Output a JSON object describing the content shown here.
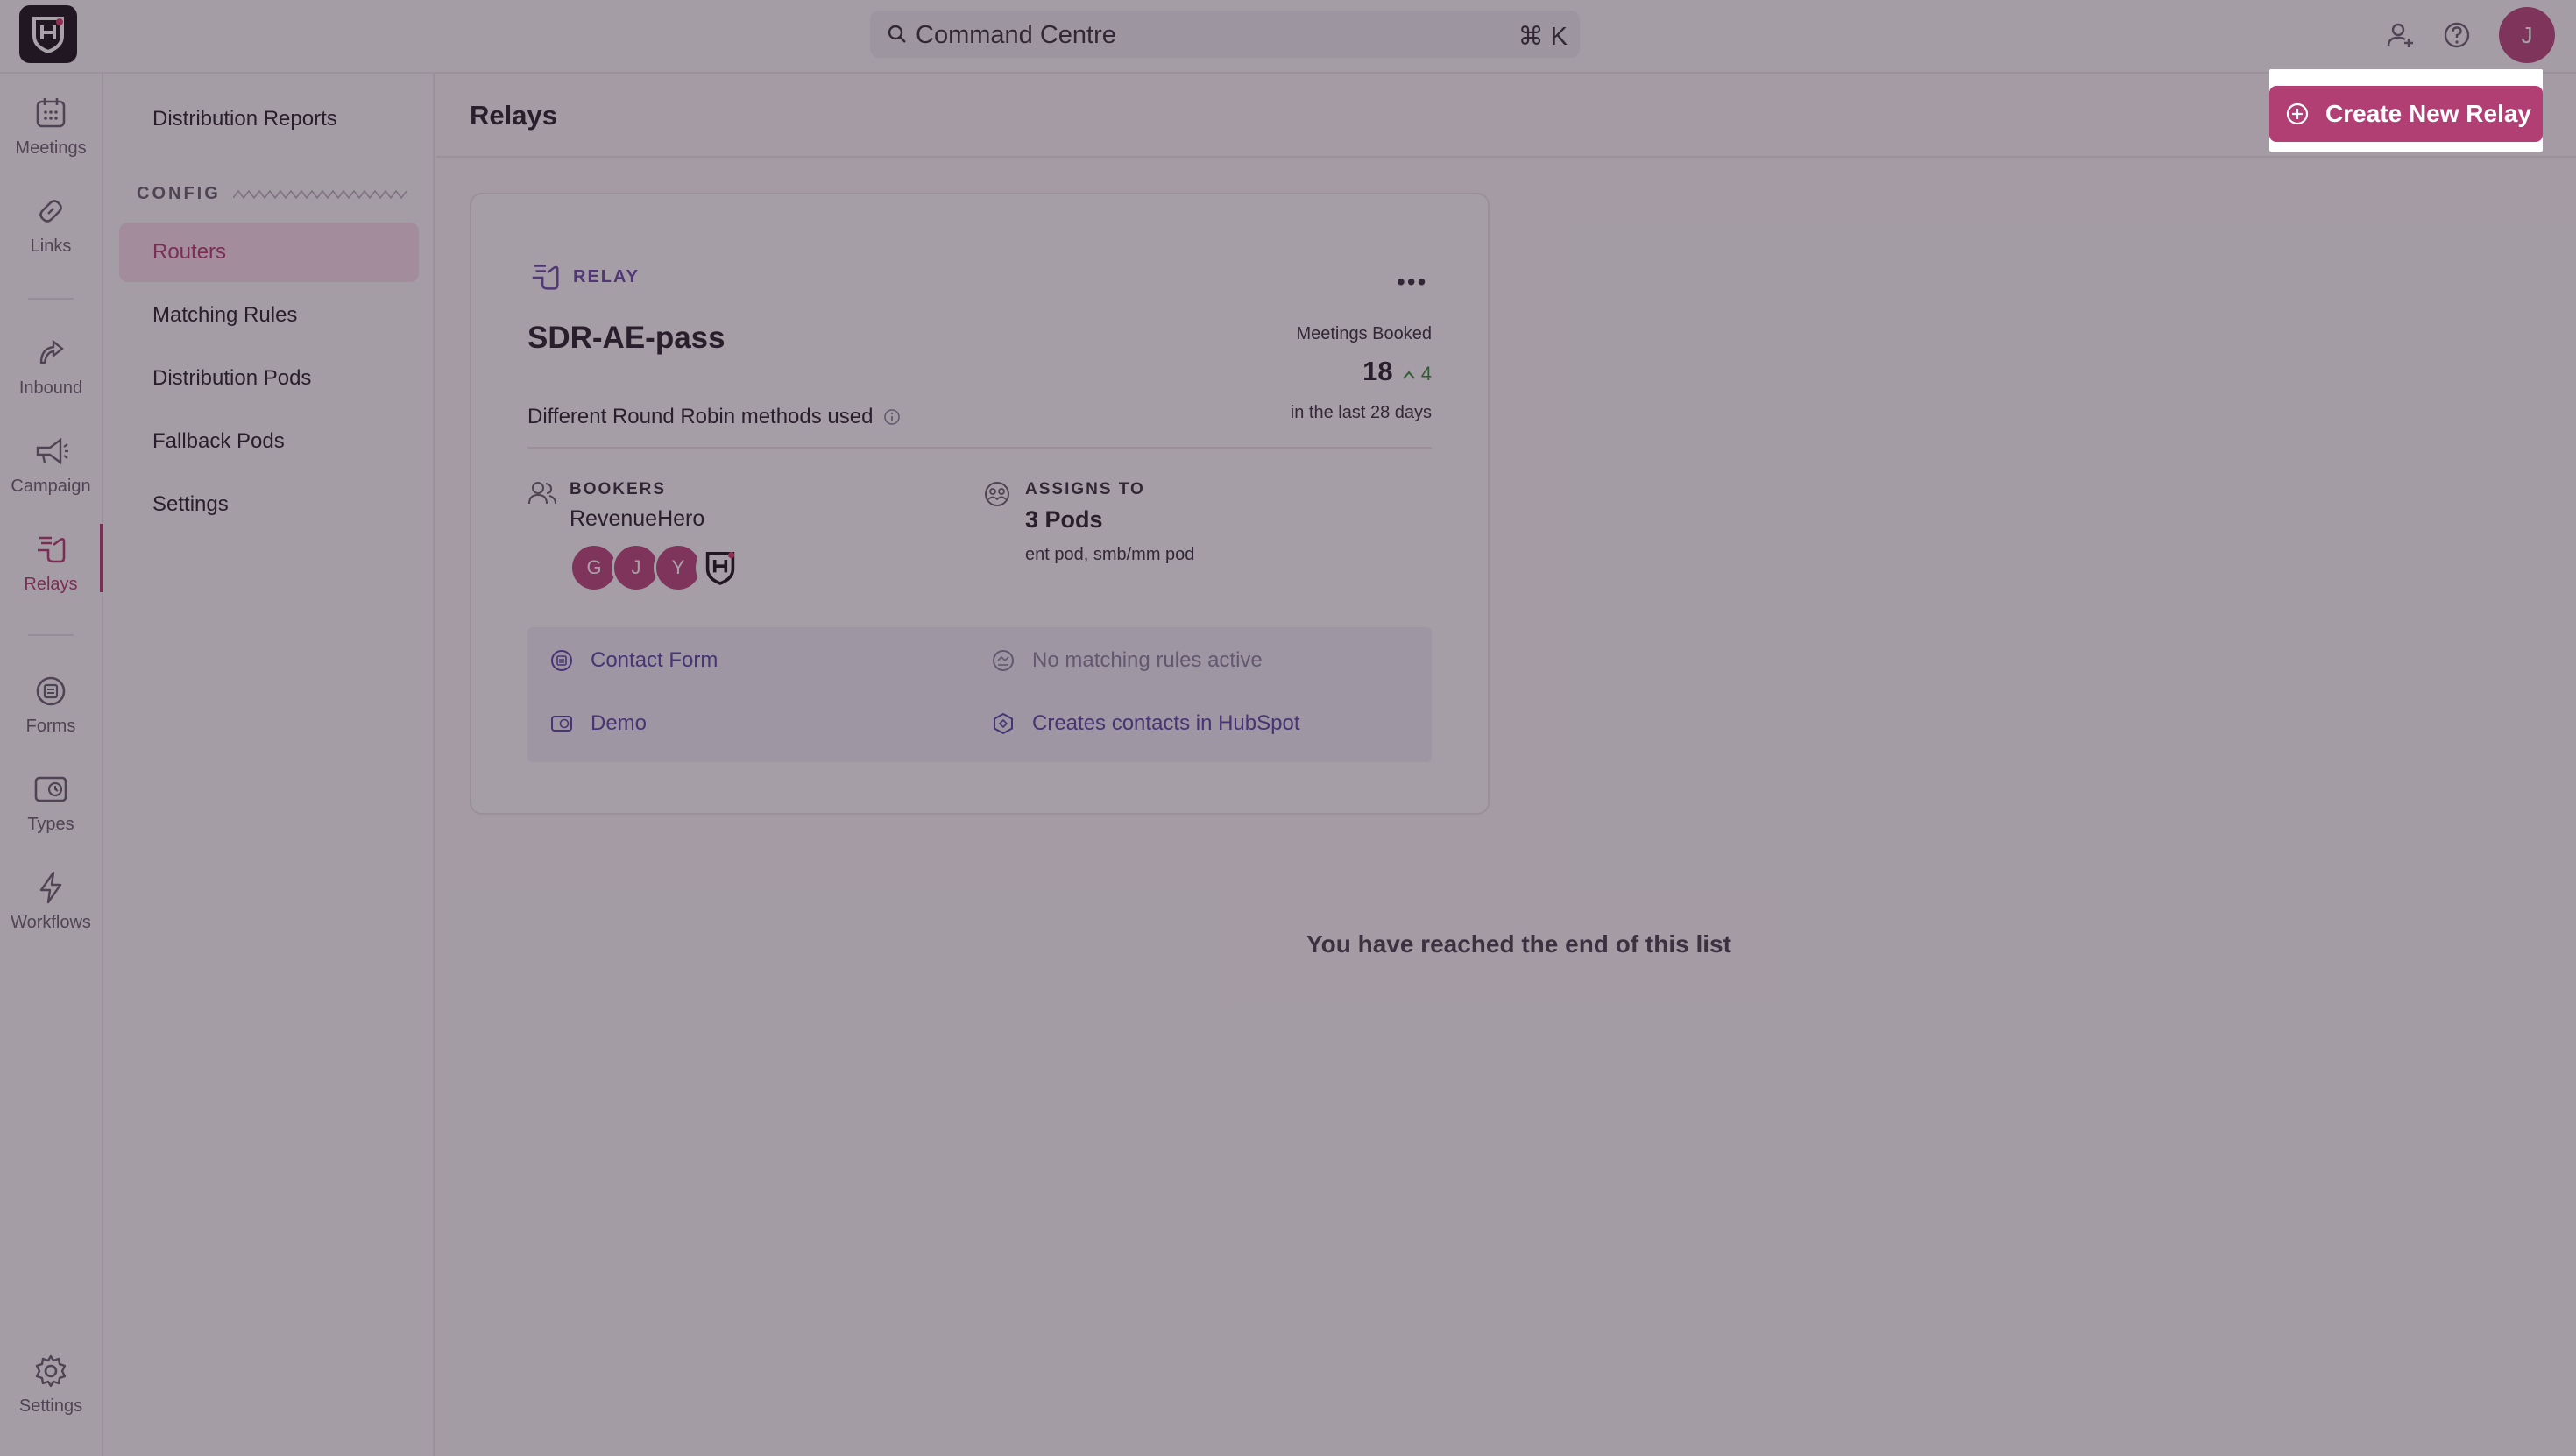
{
  "search": {
    "label": "Command Centre",
    "shortcut": "⌘ K"
  },
  "user": {
    "initial": "J"
  },
  "rail": {
    "items": [
      {
        "label": "Meetings",
        "icon": "calendar-icon"
      },
      {
        "label": "Links",
        "icon": "link-icon"
      },
      {
        "label": "Inbound",
        "icon": "inbound-icon"
      },
      {
        "label": "Campaign",
        "icon": "megaphone-icon"
      },
      {
        "label": "Relays",
        "icon": "relay-icon",
        "active": true
      },
      {
        "label": "Forms",
        "icon": "forms-icon"
      },
      {
        "label": "Types",
        "icon": "types-icon"
      },
      {
        "label": "Workflows",
        "icon": "lightning-icon"
      },
      {
        "label": "Settings",
        "icon": "gear-icon"
      }
    ]
  },
  "subnav": {
    "reports": "Distribution Reports",
    "config_label": "CONFIG",
    "items": [
      "Routers",
      "Matching Rules",
      "Distribution Pods",
      "Fallback Pods",
      "Settings"
    ],
    "active": "Routers"
  },
  "page": {
    "title": "Relays",
    "create_button": "Create New Relay",
    "end_message": "You have reached the end of this list"
  },
  "relay": {
    "tag": "RELAY",
    "name": "SDR-AE-pass",
    "description": "Different Round Robin methods used",
    "meetings_label": "Meetings Booked",
    "meetings_value": "18",
    "meetings_delta": "4",
    "meetings_period": "in the last 28 days",
    "bookers_label": "BOOKERS",
    "bookers_value": "RevenueHero",
    "booker_initials": [
      "G",
      "J",
      "Y"
    ],
    "assigns_label": "ASSIGNS TO",
    "assigns_value": "3 Pods",
    "assigns_detail": "ent pod, smb/mm pod",
    "links": {
      "form": "Contact Form",
      "rules": "No matching rules active",
      "meeting_type": "Demo",
      "crm": "Creates contacts in HubSpot"
    }
  },
  "colors": {
    "accent": "#b23f74",
    "link": "#5a4aa8",
    "delta": "#3a8a3a"
  }
}
